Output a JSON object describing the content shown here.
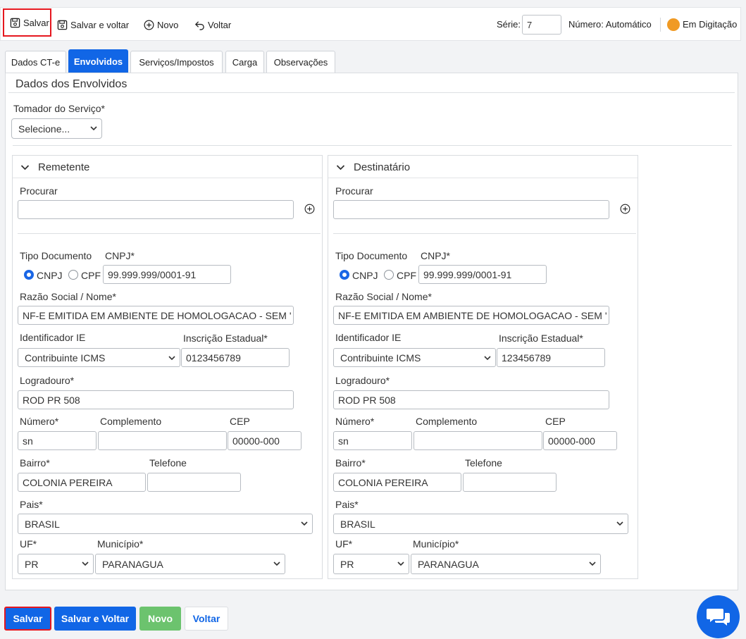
{
  "toolbar": {
    "save_label": "Salvar",
    "save_voltar_label": "Salvar e voltar",
    "novo_label": "Novo",
    "voltar_label": "Voltar",
    "serie_label": "Série:",
    "serie_value": "7",
    "numero_label": "Número: Automático",
    "status_label": "Em Digitação",
    "status_color": "#f09a24"
  },
  "tabs": [
    {
      "label": "Dados CT-e",
      "active": false
    },
    {
      "label": "Envolvidos",
      "active": true
    },
    {
      "label": "Serviços/Impostos",
      "active": false
    },
    {
      "label": "Carga",
      "active": false
    },
    {
      "label": "Observações",
      "active": false
    }
  ],
  "main": {
    "section_title": "Dados dos Envolvidos",
    "tomador_label": "Tomador do Serviço*",
    "tomador_value": "Selecione..."
  },
  "remetente": {
    "title": "Remetente",
    "procurar_label": "Procurar",
    "procurar_value": "",
    "tipo_doc_label": "Tipo Documento",
    "cnpj_label": "CNPJ*",
    "radio_cnpj": "CNPJ",
    "radio_cpf": "CPF",
    "cnpj_value": "99.999.999/0001-91",
    "razao_label": "Razão Social / Nome*",
    "razao_value": "NF-E EMITIDA EM AMBIENTE DE HOMOLOGACAO - SEM '",
    "ident_ie_label": "Identificador IE",
    "ident_ie_value": "Contribuinte ICMS",
    "ie_label": "Inscrição Estadual*",
    "ie_value": "0123456789",
    "logradouro_label": "Logradouro*",
    "logradouro_value": "ROD PR 508",
    "numero_label": "Número*",
    "numero_value": "sn",
    "complemento_label": "Complemento",
    "complemento_value": "",
    "cep_label": "CEP",
    "cep_value": "00000-000",
    "bairro_label": "Bairro*",
    "bairro_value": "COLONIA PEREIRA",
    "telefone_label": "Telefone",
    "telefone_value": "",
    "pais_label": "Pais*",
    "pais_value": "BRASIL",
    "uf_label": "UF*",
    "uf_value": "PR",
    "municipio_label": "Município*",
    "municipio_value": "PARANAGUA"
  },
  "destinatario": {
    "title": "Destinatário",
    "procurar_label": "Procurar",
    "procurar_value": "",
    "tipo_doc_label": "Tipo Documento",
    "cnpj_label": "CNPJ*",
    "radio_cnpj": "CNPJ",
    "radio_cpf": "CPF",
    "cnpj_value": "99.999.999/0001-91",
    "razao_label": "Razão Social / Nome*",
    "razao_value": "NF-E EMITIDA EM AMBIENTE DE HOMOLOGACAO - SEM '",
    "ident_ie_label": "Identificador IE",
    "ident_ie_value": "Contribuinte ICMS",
    "ie_label": "Inscrição Estadual*",
    "ie_value": "123456789",
    "logradouro_label": "Logradouro*",
    "logradouro_value": "ROD PR 508",
    "numero_label": "Número*",
    "numero_value": "sn",
    "complemento_label": "Complemento",
    "complemento_value": "",
    "cep_label": "CEP",
    "cep_value": "00000-000",
    "bairro_label": "Bairro*",
    "bairro_value": "COLONIA PEREIRA",
    "telefone_label": "Telefone",
    "telefone_value": "",
    "pais_label": "Pais*",
    "pais_value": "BRASIL",
    "uf_label": "UF*",
    "uf_value": "PR",
    "municipio_label": "Município*",
    "municipio_value": "PARANAGUA"
  },
  "footer": {
    "save_label": "Salvar",
    "save_voltar_label": "Salvar e Voltar",
    "novo_label": "Novo",
    "voltar_label": "Voltar"
  },
  "colors": {
    "primary": "#1166e6",
    "success": "#6cc36e",
    "highlight": "#e5171f"
  }
}
